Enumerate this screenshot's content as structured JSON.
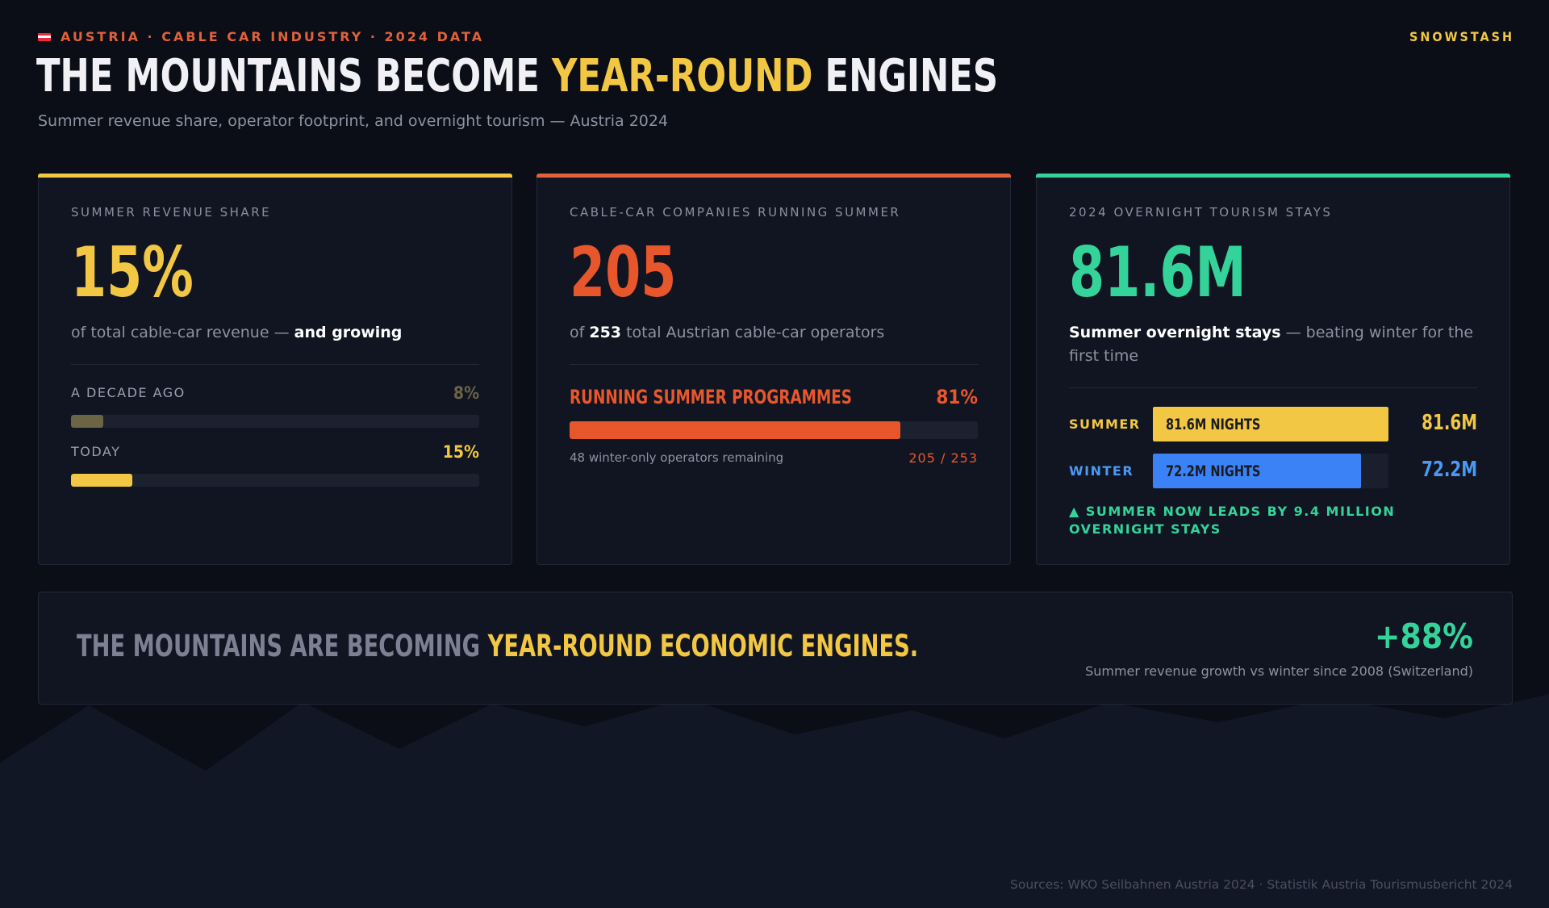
{
  "header": {
    "eyebrow": "AUSTRIA · CABLE CAR INDUSTRY · 2024 DATA",
    "brand": "SNOWSTASH",
    "title_pre": "THE MOUNTAINS BECOME ",
    "title_highlight": "YEAR-ROUND",
    "title_post": " ENGINES",
    "subtitle": "Summer revenue share, operator footprint, and overnight tourism — Austria 2024"
  },
  "colors": {
    "background": "#0b0e17",
    "yellow": "#f2c744",
    "orange": "#e8572c",
    "green": "#34d399",
    "blue": "#3b82f6",
    "muted_yellow": "#6b6445"
  },
  "card_revenue": {
    "label": "SUMMER REVENUE SHARE",
    "big": "15%",
    "desc_plain": "of total cable-car revenue — ",
    "desc_bold": "and growing",
    "rows": [
      {
        "label": "A DECADE AGO",
        "value": "8%",
        "fraction": 0.08
      },
      {
        "label": "TODAY",
        "value": "15%",
        "fraction": 0.15
      }
    ]
  },
  "card_companies": {
    "label": "CABLE-CAR COMPANIES RUNNING SUMMER",
    "big": "205",
    "desc_pre": "of ",
    "desc_bold": "253",
    "desc_post": " total Austrian cable-car operators",
    "progress_title": "RUNNING SUMMER PROGRAMMES",
    "progress_pct": "81%",
    "progress_fraction": 0.81,
    "note_left": "48 winter-only operators remaining",
    "note_right": "205 / 253"
  },
  "card_overnight": {
    "label": "2024 OVERNIGHT TOURISM STAYS",
    "big": "81.6M",
    "desc_bold": "Summer overnight stays",
    "desc_plain": " — beating winter for the first time",
    "rows": [
      {
        "label": "SUMMER",
        "bar_text": "81.6M NIGHTS",
        "value": "81.6M",
        "fraction": 1.0
      },
      {
        "label": "WINTER",
        "bar_text": "72.2M NIGHTS",
        "value": "72.2M",
        "fraction": 0.885
      }
    ],
    "lead_icon": "up-triangle-icon",
    "lead_text": "▲ SUMMER NOW LEADS BY 9.4 MILLION OVERNIGHT STAYS"
  },
  "banner": {
    "text_pre": "THE MOUNTAINS ARE BECOMING ",
    "text_highlight": "YEAR-ROUND ECONOMIC ENGINES.",
    "stat": "+88%",
    "stat_note": "Summer revenue growth vs winter since 2008 (Switzerland)"
  },
  "footer": {
    "sources": "Sources: WKO Seilbahnen Austria 2024 · Statistik Austria Tourismusbericht 2024"
  }
}
